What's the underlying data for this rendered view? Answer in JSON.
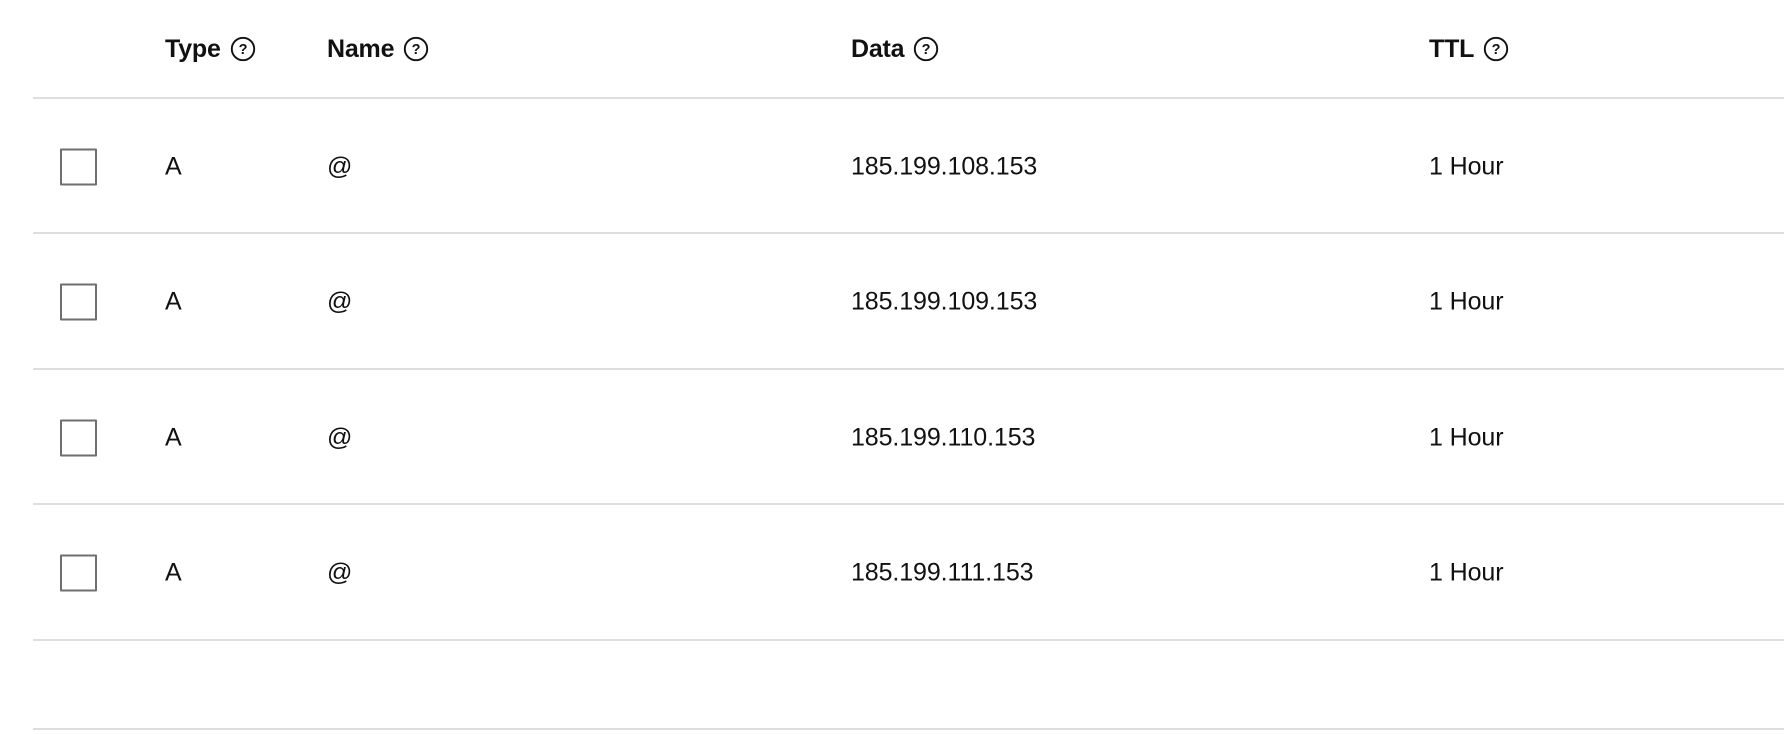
{
  "table": {
    "columns": [
      {
        "key": "select",
        "label": "",
        "help": false
      },
      {
        "key": "type",
        "label": "Type",
        "help": true,
        "help_icon": "help-circle-icon"
      },
      {
        "key": "name",
        "label": "Name",
        "help": true,
        "help_icon": "help-circle-icon"
      },
      {
        "key": "data",
        "label": "Data",
        "help": true,
        "help_icon": "help-circle-icon"
      },
      {
        "key": "ttl",
        "label": "TTL",
        "help": true,
        "help_icon": "help-circle-icon"
      }
    ],
    "headers": {
      "type": "Type",
      "name": "Name",
      "data": "Data",
      "ttl": "TTL"
    },
    "rows": [
      {
        "selected": false,
        "type": "A",
        "name": "@",
        "data": "185.199.108.153",
        "ttl": "1 Hour"
      },
      {
        "selected": false,
        "type": "A",
        "name": "@",
        "data": "185.199.109.153",
        "ttl": "1 Hour"
      },
      {
        "selected": false,
        "type": "A",
        "name": "@",
        "data": "185.199.110.153",
        "ttl": "1 Hour"
      },
      {
        "selected": false,
        "type": "A",
        "name": "@",
        "data": "185.199.111.153",
        "ttl": "1 Hour"
      }
    ],
    "row_count": 4
  },
  "colors": {
    "text": "#111111",
    "divider": "#dcdfe2",
    "checkbox_border": "#6f6f6f",
    "background": "#ffffff"
  }
}
